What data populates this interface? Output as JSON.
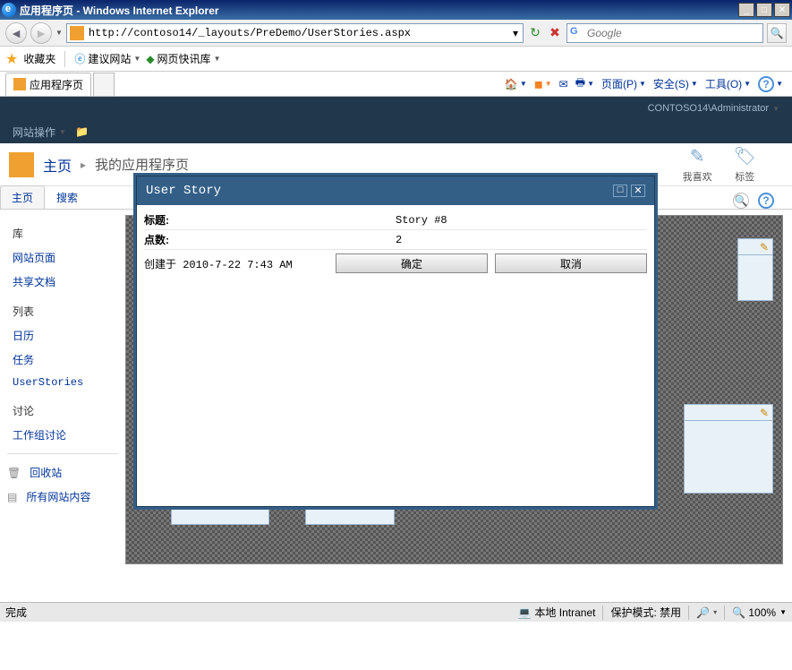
{
  "window": {
    "title": "应用程序页 - Windows Internet Explorer"
  },
  "nav": {
    "url": "http://contoso14/_layouts/PreDemo/UserStories.aspx",
    "search_placeholder": "Google"
  },
  "favbar": {
    "favorites": "收藏夹",
    "suggested": "建议网站",
    "slice": "网页快讯库"
  },
  "tab": {
    "title": "应用程序页"
  },
  "cmd": {
    "page": "页面(P)",
    "safety": "安全(S)",
    "tools": "工具(O)"
  },
  "sp": {
    "user": "CONTOSO14\\Administrator",
    "site_actions": "网站操作",
    "home": "主页",
    "breadcrumb": "我的应用程序页",
    "like": "我喜欢",
    "tags": "标签",
    "tabs": {
      "home": "主页",
      "search": "搜索"
    },
    "nav": {
      "libs": "库",
      "pages": "网站页面",
      "shared": "共享文档",
      "lists": "列表",
      "calendar": "日历",
      "tasks": "任务",
      "userstories": "UserStories",
      "discuss": "讨论",
      "teamdiscuss": "工作组讨论",
      "recycle": "回收站",
      "allcontent": "所有网站内容"
    }
  },
  "dialog": {
    "title": "User Story",
    "label_title": "标题:",
    "label_points": "点数:",
    "value_title": "Story #8",
    "value_points": "2",
    "created_label": "创建于",
    "created_value": "2010-7-22 7:43 AM",
    "ok": "确定",
    "cancel": "取消"
  },
  "status": {
    "done": "完成",
    "zone": "本地 Intranet",
    "mode": "保护模式: 禁用",
    "zoom": "100%"
  }
}
